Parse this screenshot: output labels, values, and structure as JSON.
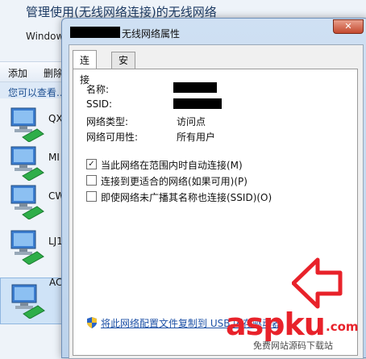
{
  "background_window": {
    "title": "管理使用(无线网络连接)的无线网络",
    "subtitle": "Window",
    "toolbar": {
      "add": "添加",
      "delete": "删除"
    },
    "info": "您可以查看...",
    "items": [
      {
        "label": "QX"
      },
      {
        "label": "MI"
      },
      {
        "label": "CW"
      },
      {
        "label": "LJ1"
      },
      {
        "label": "AC"
      }
    ]
  },
  "dialog": {
    "title": "无线网络属性",
    "close_label": "✕",
    "tabs": [
      {
        "label": "连接"
      },
      {
        "label": "安全"
      }
    ],
    "fields": [
      {
        "label": "名称:",
        "value": "",
        "redacted": true
      },
      {
        "label": "SSID:",
        "value": "",
        "redacted": true
      },
      {
        "label": "网络类型:",
        "value": "访问点"
      },
      {
        "label": "网络可用性:",
        "value": "所有用户"
      }
    ],
    "checkboxes": [
      {
        "label": "当此网络在范围内时自动连接(M)",
        "checked": true
      },
      {
        "label": "连接到更适合的网络(如果可用)(P)",
        "checked": false
      },
      {
        "label": "即使网络未广播其名称也连接(SSID)(O)",
        "checked": false
      }
    ],
    "copy_link": "将此网络配置文件复制到 USB 闪存驱动器"
  },
  "watermark": {
    "brand": "aspku",
    "domain": ".com",
    "slogan": "免费网站源码下载站"
  },
  "colors": {
    "link": "#1c50a6",
    "arrow": "#e8222a",
    "accent": "#1c3a63"
  },
  "icons": {
    "network": "network-computer-icon",
    "shield": "uac-shield-icon",
    "arrow": "left-arrow-icon"
  }
}
